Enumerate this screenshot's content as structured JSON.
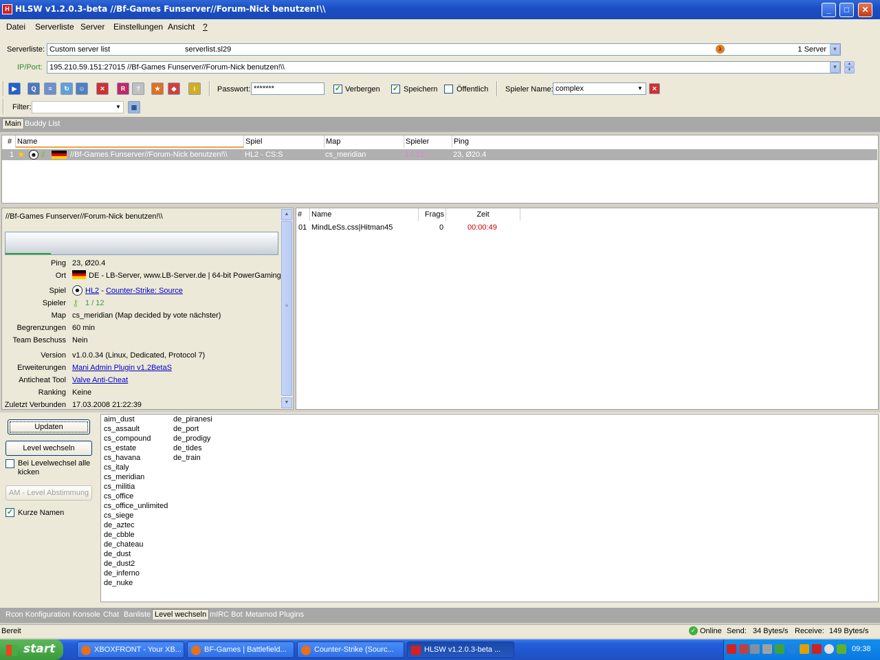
{
  "window": {
    "title": "HLSW v1.2.0.3-beta   //Bf-Games Funserver//Forum-Nick benutzen!\\\\"
  },
  "menu": [
    "Datei",
    "Serverliste",
    "Server",
    "Einstellungen",
    "Ansicht",
    "?"
  ],
  "serverliste": {
    "label": "Serverliste:",
    "name": "Custom server list",
    "file": "serverlist.sl29",
    "count": "1 Server"
  },
  "ipport": {
    "label": "IP/Port:",
    "value": "195.210.59.151:27015 //Bf-Games Funserver//Forum-Nick benutzen!\\\\"
  },
  "toolbar": {
    "passwort_label": "Passwort:",
    "passwort_value": "*******",
    "verbergen": "Verbergen",
    "speichern": "Speichern",
    "oeffentlich": "Öffentlich",
    "spieler_name_label": "Spieler Name:",
    "spieler_name_value": "complex"
  },
  "filter": {
    "label": "Filter:"
  },
  "tabs": [
    "Main",
    "Buddy List"
  ],
  "server_table": {
    "headers": [
      "#",
      "Name",
      "Spiel",
      "Map",
      "Spieler",
      "Ping"
    ],
    "rows": [
      {
        "num": "1",
        "name": "//Bf-Games Funserver//Forum-Nick benutzen!\\\\",
        "spiel": "HL2 - CS:S",
        "map": "cs_meridian",
        "spieler": "1 / 12",
        "ping": "23, Ø20.4"
      }
    ]
  },
  "info": {
    "title": "//Bf-Games Funserver//Forum-Nick benutzen!\\\\",
    "ping_k": "Ping",
    "ping_v": "23, Ø20.4",
    "ort_k": "Ort",
    "ort_v": "DE - LB-Server, www.LB-Server.de | 64-bit PowerGaming",
    "spiel_k": "Spiel",
    "spiel_hl2": "HL2",
    "spiel_dash": " - ",
    "spiel_cs": "Counter-Strike: Source",
    "spieler_k": "Spieler",
    "spieler_v": "1 / 12",
    "map_k": "Map",
    "map_v": "cs_meridian (Map decided by vote nächster)",
    "begrenzungen_k": "Begrenzungen",
    "begrenzungen_v": "60 min",
    "team_k": "Team Beschuss",
    "team_v": "Nein",
    "version_k": "Version",
    "version_v": "v1.0.0.34 (Linux, Dedicated, Protocol 7)",
    "erweiterungen_k": "Erweiterungen",
    "erweiterungen_v": "Mani Admin Plugin v1.2BetaS",
    "anticheat_k": "Anticheat Tool",
    "anticheat_v": "Valve Anti-Cheat",
    "ranking_k": "Ranking",
    "ranking_v": "Keine",
    "zuletzt_k": "Zuletzt Verbunden",
    "zuletzt_v": "17.03.2008 21:22:39"
  },
  "player_table": {
    "headers": [
      "#",
      "Name",
      "Frags",
      "Zeit"
    ],
    "rows": [
      {
        "num": "01",
        "name": "MindLeSs.css|Hitman45",
        "frags": "0",
        "zeit": "00:00:49"
      }
    ]
  },
  "level": {
    "updaten": "Updaten",
    "level_wechseln": "Level wechseln",
    "kick_all": "Bei Levelwechsel alle kicken",
    "am_vote": "AM - Level Abstimmung",
    "kurze_namen": "Kurze Namen",
    "maps_col1": [
      "aim_dust",
      "cs_assault",
      "cs_compound",
      "cs_estate",
      "cs_havana",
      "cs_italy",
      "cs_meridian",
      "cs_militia",
      "cs_office",
      "cs_office_unlimited",
      "cs_siege",
      "de_aztec",
      "de_cbble",
      "de_chateau",
      "de_dust",
      "de_dust2",
      "de_inferno",
      "de_nuke"
    ],
    "maps_col2": [
      "de_piranesi",
      "de_port",
      "de_prodigy",
      "de_tides",
      "de_train"
    ]
  },
  "bottom_tabs": [
    "Rcon Konfiguration",
    "Konsole",
    "Chat",
    "Banliste",
    "Level wechseln",
    "mIRC Bot",
    "Metamod Plugins"
  ],
  "status": {
    "left": "Bereit",
    "online": "Online",
    "send_label": "Send:",
    "send_value": "34 Bytes/s",
    "receive_label": "Receive:",
    "receive_value": "149 Bytes/s"
  },
  "taskbar": {
    "start": "start",
    "tasks": [
      "XBOXFRONT - Your XB...",
      "BF-Games | Battlefield...",
      "Counter-Strike (Sourc...",
      "HLSW v1.2.0.3-beta  ..."
    ],
    "clock": "09:38"
  },
  "colors": {
    "link": "#0000c8",
    "zeit": "#cc0000",
    "selected_row": "#b0b0b0"
  }
}
